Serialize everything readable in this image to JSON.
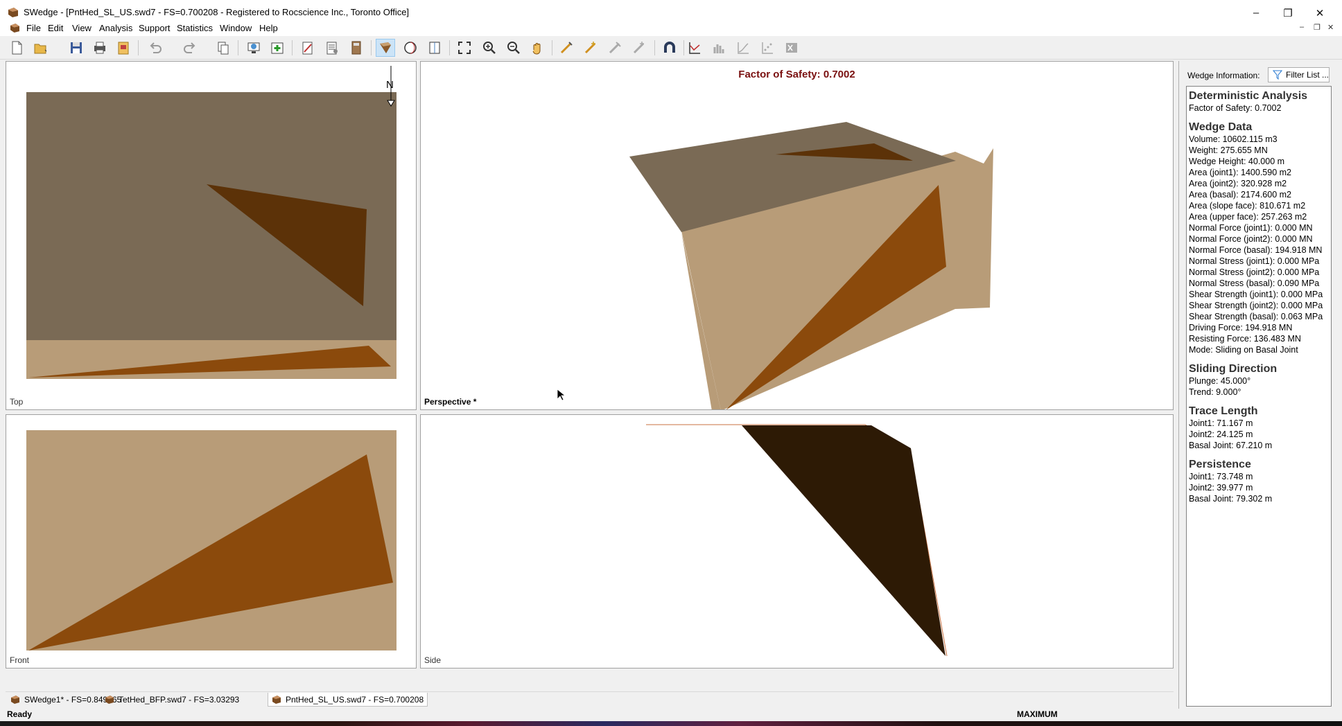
{
  "window": {
    "title": "SWedge - [PntHed_SL_US.swd7 - FS=0.700208 - Registered to Rocscience Inc., Toronto Office]",
    "controls": {
      "minimize": "–",
      "restore": "❐",
      "close": "✕"
    }
  },
  "menu": [
    "File",
    "Edit",
    "View",
    "Analysis",
    "Support",
    "Statistics",
    "Window",
    "Help"
  ],
  "mdi_controls": {
    "minimize": "–",
    "restore": "❐",
    "close": "✕"
  },
  "toolbar": {
    "groups": [
      [
        "new-file-icon",
        "open-file-icon",
        "save-icon",
        "print-icon",
        "export-icon"
      ],
      [
        "undo-icon",
        "redo-icon",
        "copy-icon"
      ],
      [
        "project-settings-icon",
        "add-icon"
      ],
      [
        "input-data-icon",
        "sensitivity-icon",
        "calculator-icon"
      ],
      [
        "wedge-view-icon",
        "stereonet-icon",
        "four-view-icon"
      ],
      [
        "zoom-all-icon",
        "zoom-in-icon",
        "zoom-out-icon",
        "pan-icon"
      ],
      [
        "add-bolt-icon",
        "add-pressure-icon",
        "add-shotcrete-icon",
        "add-force-icon"
      ],
      [
        "magnet-icon"
      ],
      [
        "chart-icon",
        "histogram-icon",
        "cumulative-icon",
        "scatter-icon",
        "excel-icon"
      ]
    ]
  },
  "views": {
    "top": {
      "label": "Top",
      "north": "N"
    },
    "perspective": {
      "label": "Perspective *",
      "title": "Factor of Safety: 0.7002"
    },
    "front": {
      "label": "Front"
    },
    "side": {
      "label": "Side"
    }
  },
  "colors": {
    "slope_top": "#7a6a55",
    "slope_face": "#b89c78",
    "wedge": "#8b4a0c",
    "wedge_dark": "#5c3208",
    "wedge_side": "#2d1a05",
    "fos_text": "#7a1010"
  },
  "info_panel": {
    "header_label": "Wedge Information:",
    "filter_button": "Filter List ...",
    "sections": [
      {
        "title": "Deterministic Analysis",
        "rows": [
          "Factor of Safety: 0.7002"
        ]
      },
      {
        "title": "Wedge Data",
        "rows": [
          "Volume: 10602.115 m3",
          "Weight: 275.655 MN",
          "Wedge Height: 40.000 m",
          "Area (joint1): 1400.590 m2",
          "Area (joint2): 320.928 m2",
          "Area (basal): 2174.600 m2",
          "Area (slope face): 810.671 m2",
          "Area (upper face): 257.263 m2",
          "Normal Force (joint1): 0.000 MN",
          "Normal Force (joint2): 0.000 MN",
          "Normal Force (basal): 194.918 MN",
          "Normal Stress (joint1): 0.000 MPa",
          "Normal Stress (joint2): 0.000 MPa",
          "Normal Stress (basal): 0.090 MPa",
          "Shear Strength (joint1): 0.000 MPa",
          "Shear Strength (joint2): 0.000 MPa",
          "Shear Strength (basal): 0.063 MPa",
          "Driving Force: 194.918 MN",
          "Resisting Force: 136.483 MN",
          "Mode: Sliding on Basal Joint"
        ]
      },
      {
        "title": "Sliding Direction",
        "rows": [
          "Plunge: 45.000°",
          "Trend: 9.000°"
        ]
      },
      {
        "title": "Trace Length",
        "rows": [
          "Joint1: 71.167 m",
          "Joint2: 24.125 m",
          "Basal Joint: 67.210 m"
        ]
      },
      {
        "title": "Persistence",
        "rows": [
          "Joint1: 73.748 m",
          "Joint2: 39.977 m",
          "Basal Joint: 79.302 m"
        ]
      }
    ]
  },
  "doc_tabs": [
    {
      "label": "SWedge1* - FS=0.849365",
      "active": false
    },
    {
      "label": "TetHed_BFP.swd7 - FS=3.03293",
      "active": false
    },
    {
      "label": "PntHed_SL_US.swd7 - FS=0.700208",
      "active": true
    }
  ],
  "status": {
    "text": "Ready",
    "indicator": "MAXIMUM"
  }
}
